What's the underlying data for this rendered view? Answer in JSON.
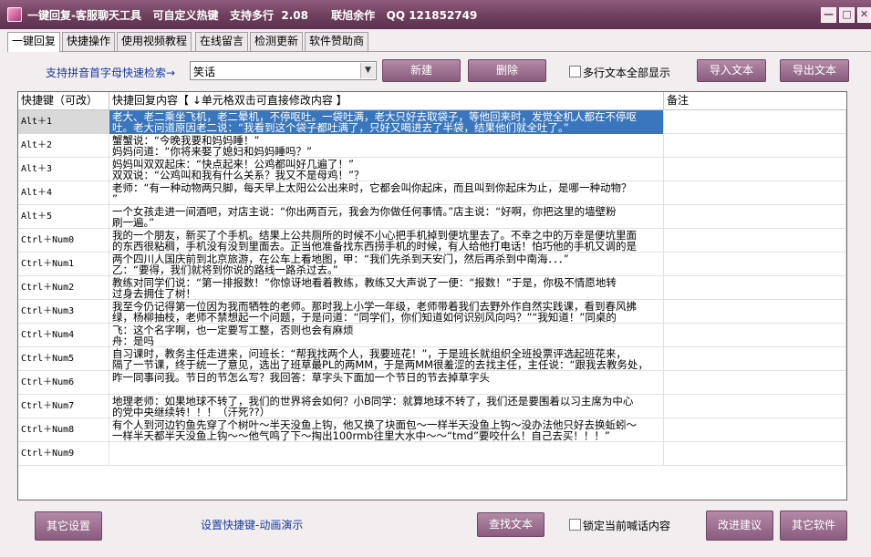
{
  "window": {
    "title": "一键回复-客服聊天工具   可自定义热键   支持多行  2.08      联旭余作   QQ 121852749",
    "min_label": "—",
    "max_label": "□",
    "close_label": "✕"
  },
  "tabs": [
    "一键回复",
    "快捷操作",
    "使用视频教程",
    "在线留言",
    "检测更新",
    "软件赞助商"
  ],
  "toolbar": {
    "search_label": "支持拼音首字母快速检索→",
    "search_value": "笑话",
    "new_label": "新建",
    "delete_label": "删除",
    "multiline_label": "多行文本全部显示",
    "import_label": "导入文本",
    "export_label": "导出文本"
  },
  "grid": {
    "headers": [
      "快捷键（可改）",
      "快捷回复内容【 ↓单元格双击可直接修改内容 】",
      "备注"
    ],
    "rows": [
      {
        "key": "Alt＋1",
        "lines": [
          "老大、老二乘坐飞机，老二晕机，不停呕吐。一袋吐满，老大只好去取袋子，等他回来时，发觉全机人都在不停呕",
          "吐。老大问道原因老二说：“我看到这个袋子都吐满了，只好又喝进去了半袋，结果他们就全吐了。”"
        ]
      },
      {
        "key": "Alt＋2",
        "lines": [
          "蟹蟹说：“今晚我要和妈妈睡！”",
          "妈妈问道：“你将来娶了媳妇和妈妈睡吗？”"
        ]
      },
      {
        "key": "Alt＋3",
        "lines": [
          "妈妈叫双双起床：“快点起来！公鸡都叫好几遍了！”",
          "双双说：“公鸡叫和我有什么关系？我又不是母鸡！”？"
        ]
      },
      {
        "key": "Alt＋4",
        "lines": [
          "老师：“有一种动物两只脚，每天早上太阳公公出来时，它都会叫你起床，而且叫到你起床为止，是哪一种动物？",
          "”"
        ]
      },
      {
        "key": "Alt＋5",
        "lines": [
          "一个女孩走进一间酒吧，对店主说：“你出两百元，我会为你做任何事情。”店主说：“好啊，你把这里的墙壁粉",
          "刷一遍。”"
        ]
      },
      {
        "key": "Ctrl＋Num0",
        "lines": [
          "我的一个朋友，新买了个手机。结果上公共厕所的时候不小心把手机掉到便坑里去了。不幸之中的万幸是便坑里面",
          "的东西很粘稠，手机没有没到里面去。正当他准备找东西捞手机的时候，有人给他打电话！怕巧他的手机又调的是"
        ]
      },
      {
        "key": "Ctrl＋Num1",
        "lines": [
          "两个四川人国庆前到北京旅游，在公车上看地图，甲：“我们先杀到天安门，然后再杀到中南海．．．”",
          "乙：“要得，我们就将到你说的路线一路杀过去。”"
        ]
      },
      {
        "key": "Ctrl＋Num2",
        "lines": [
          "教练对同学们说：“第一排报数！”你惊讶地看着教练，教练又大声说了一便：“报数！”于是，你极不情愿地转",
          "过身去拥住了树！"
        ]
      },
      {
        "key": "Ctrl＋Num3",
        "lines": [
          "我至今仍记得第一位因为我而牺牲的老师。那时我上小学一年级，老师带着我们去野外作自然实践课，看到春风拂",
          "绿，杨柳抽枝，老师不禁想起一个问题，于是问道：“同学们，你们知道如何识别风向吗？”“我知道！”同桌的"
        ]
      },
      {
        "key": "Ctrl＋Num4",
        "lines": [
          "飞：这个名字啊，也一定要写工整，否则也会有麻烦",
          "舟：是吗"
        ]
      },
      {
        "key": "Ctrl＋Num5",
        "lines": [
          "自习课时，教务主任走进来，问班长：“帮我找两个人，我要班花！”，于是班长就组织全班投票评选起班花来，",
          "隔了一节课，终于统一了意见，选出了班草最PL的两MM，于是两MM很羞涩的去找主任，主任说：“跟我去教务处，"
        ]
      },
      {
        "key": "Ctrl＋Num6",
        "lines": [
          "昨一同事问我。节日的节怎么写？我回答：草字头下面加一个节日的节去掉草字头"
        ]
      },
      {
        "key": "Ctrl＋Num7",
        "lines": [
          "地理老师：如果地球不转了，我们的世界将会如何？小B同学：就算地球不转了，我们还是要围着以习主席为中心",
          "的党中央继续转！！！（汗死??）"
        ]
      },
      {
        "key": "Ctrl＋Num8",
        "lines": [
          "有个人到河边钓鱼先穿了个树叶～半天没鱼上钩，他又换了块面包～一样半天没鱼上钩～没办法他只好去换蚯蚓～",
          "一样半天都半天没鱼上钩～～他气鸣了下～掏出100rmb往里大水中～～“tmd”要咬什么！自己去买！！！”"
        ]
      },
      {
        "key": "Ctrl＋Num9",
        "lines": [
          ""
        ]
      }
    ]
  },
  "bottom": {
    "other_settings_label": "其它设置",
    "hotkey_demo_label": "设置快捷键-动画演示",
    "find_text_label": "查找文本",
    "lock_label": "锁定当前喊话内容",
    "suggest_label": "改进建议",
    "other_software_label": "其它软件"
  }
}
